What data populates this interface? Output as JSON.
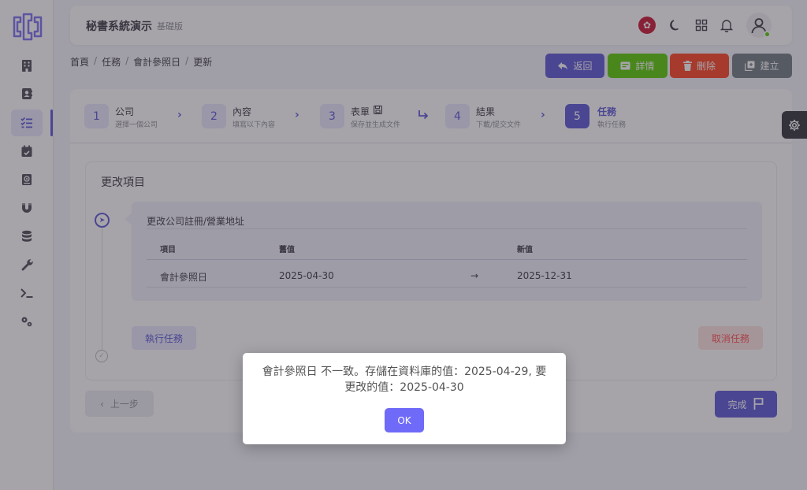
{
  "app": {
    "title": "秘書系統演示",
    "edition": "基礎版"
  },
  "header": {
    "icons": [
      "hk-flag-icon",
      "moon-icon",
      "grid-icon",
      "bell-icon",
      "user-icon"
    ]
  },
  "sidebar": {
    "items": [
      "building-icon",
      "contact-book-icon",
      "task-list-icon",
      "calendar-check-icon",
      "address-book-icon",
      "magnet-icon",
      "database-icon",
      "wrench-icon",
      "terminal-icon",
      "gears-icon"
    ],
    "active_index": 2
  },
  "breadcrumb": [
    "首頁",
    "任務",
    "會計參照日",
    "更新"
  ],
  "actions": [
    {
      "label": "返回",
      "icon": "reply-icon",
      "color": "#5a54d6"
    },
    {
      "label": "詳情",
      "icon": "card-icon",
      "color": "#56ca00"
    },
    {
      "label": "刪除",
      "icon": "trash-icon",
      "color": "#ff3e1d"
    },
    {
      "label": "建立",
      "icon": "copy-icon",
      "color": "#6d7880"
    }
  ],
  "steps": [
    {
      "num": "1",
      "title": "公司",
      "sub": "選擇一個公司"
    },
    {
      "num": "2",
      "title": "內容",
      "sub": "填寫以下內容"
    },
    {
      "num": "3",
      "title": "表單",
      "sub": "保存並生成文件"
    },
    {
      "num": "4",
      "title": "結果",
      "sub": "下載/提交文件"
    },
    {
      "num": "5",
      "title": "任務",
      "sub": "執行任務",
      "active": true
    }
  ],
  "panel": {
    "title": "更改項目",
    "change_title": "更改公司註冊/營業地址",
    "columns": [
      "項目",
      "舊值",
      "新值"
    ],
    "row": {
      "item": "會計參照日",
      "old": "2025-04-30",
      "arrow": "→",
      "new": "2025-12-31"
    },
    "run_label": "執行任務",
    "cancel_label": "取消任務"
  },
  "nav": {
    "prev_label": "上一步",
    "done_label": "完成"
  },
  "dialog": {
    "message": "會計參照日 不一致。存儲在資料庫的值：2025-04-29, 要更改的值：2025-04-30",
    "ok_label": "OK"
  }
}
